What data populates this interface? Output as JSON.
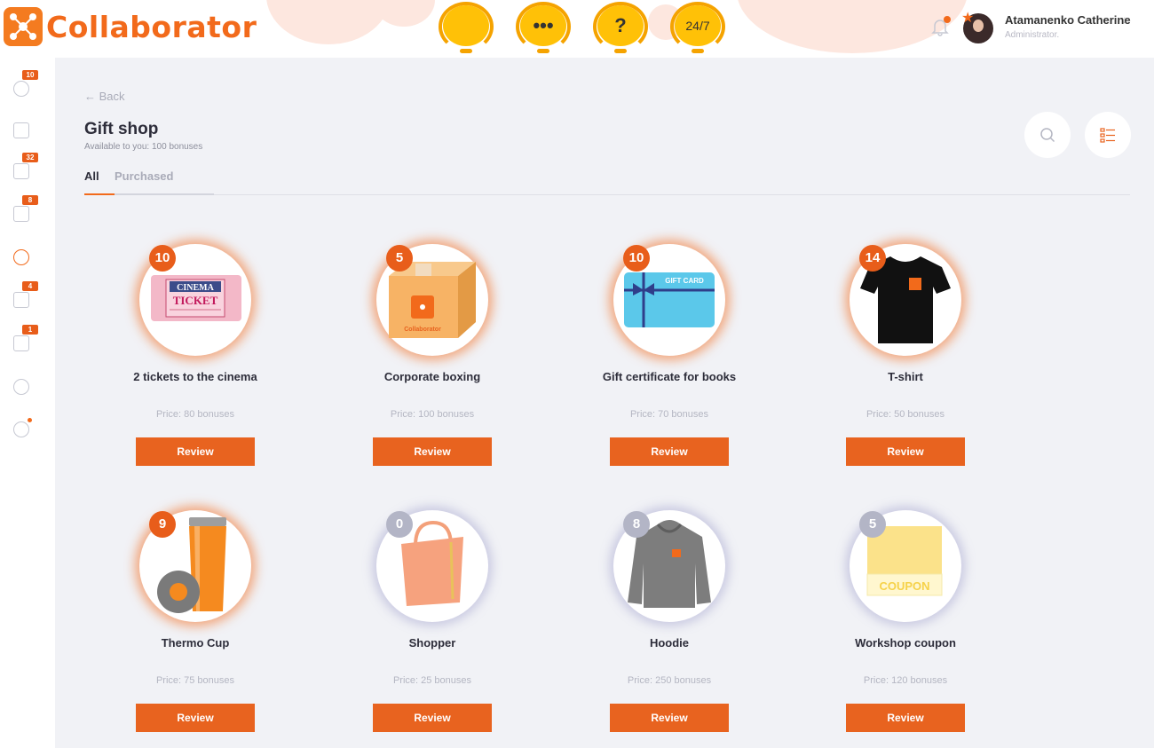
{
  "header": {
    "logo_text": "Collaborator",
    "support_buttons": [
      {
        "icon": "chat-icon",
        "label": ""
      },
      {
        "icon": "more-icon",
        "label": "•••"
      },
      {
        "icon": "help-icon",
        "label": "?"
      },
      {
        "icon": "support-24-7-icon",
        "label": "24/7"
      }
    ],
    "user_name": "Atamanenko Catherine",
    "user_role": "Administrator.",
    "user_caret": "↓"
  },
  "sidebar": {
    "items": [
      {
        "name": "users",
        "badge": "10"
      },
      {
        "name": "courses",
        "badge": ""
      },
      {
        "name": "documents",
        "badge": "32"
      },
      {
        "name": "reports",
        "badge": "8"
      },
      {
        "name": "gift-shop",
        "badge": ""
      },
      {
        "name": "tasks",
        "badge": "4"
      },
      {
        "name": "messages",
        "badge": "1"
      },
      {
        "name": "settings",
        "badge": ""
      },
      {
        "name": "help",
        "badge": ""
      }
    ]
  },
  "page": {
    "back_label": "← Back",
    "title": "Gift shop",
    "subtitle": "Available to you: 100 bonuses",
    "tabs": [
      "All",
      "Purchased"
    ]
  },
  "products": [
    {
      "name": "2 tickets to the cinema",
      "qty": "10",
      "price": "Price: 80 bonuses",
      "button": "Review",
      "ticket_line1": "CINEMA",
      "ticket_line2": "TICKET"
    },
    {
      "name": "Corporate boxing",
      "qty": "5",
      "price": "Price: 100 bonuses",
      "button": "Review",
      "box_label": "Collaborator"
    },
    {
      "name": "Gift certificate for books",
      "qty": "10",
      "price": "Price: 70 bonuses",
      "button": "Review",
      "card_label": "GIFT CARD"
    },
    {
      "name": "T-shirt",
      "qty": "14",
      "price": "Price: 50 bonuses",
      "button": "Review"
    },
    {
      "name": "Thermo Cup",
      "qty": "9",
      "price": "Price: 75 bonuses",
      "button": "Review"
    },
    {
      "name": "Shopper",
      "qty": "0",
      "price": "Price: 25 bonuses",
      "button": "Review"
    },
    {
      "name": "Hoodie",
      "qty": "8",
      "price": "Price: 250 bonuses",
      "button": "Review"
    },
    {
      "name": "Workshop coupon",
      "qty": "5",
      "price": "Price: 120 bonuses",
      "button": "Review",
      "coupon_label": "COUPON"
    }
  ],
  "colors": {
    "accent": "#e8631f",
    "background": "#f1f2f6",
    "support_yellow": "#ffc107"
  }
}
